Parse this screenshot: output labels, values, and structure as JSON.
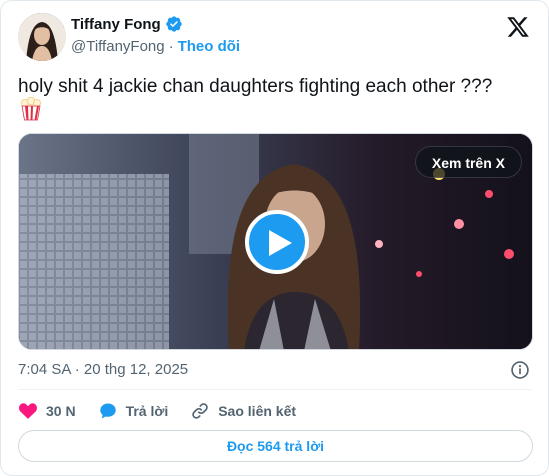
{
  "author": {
    "display_name": "Tiffany Fong",
    "handle": "@TiffanyFong",
    "separator": "·",
    "follow_label": "Theo dõi",
    "verified": true
  },
  "tweet": {
    "text": "holy shit 4 jackie chan daughters fighting each other ???",
    "emoji_icon": "popcorn-icon"
  },
  "media": {
    "view_on_x_label": "Xem trên X",
    "play_icon": "play-icon"
  },
  "meta": {
    "timestamp": "7:04 SA · 20 thg 12, 2025"
  },
  "actions": {
    "like_count": "30 N",
    "reply_label": "Trả lời",
    "copy_link_label": "Sao liên kết"
  },
  "read_replies_label": "Đọc 564 trả lời",
  "colors": {
    "accent": "#1d9bf0",
    "like": "#f91880",
    "secondary_text": "#536471",
    "primary_text": "#0f1419"
  }
}
